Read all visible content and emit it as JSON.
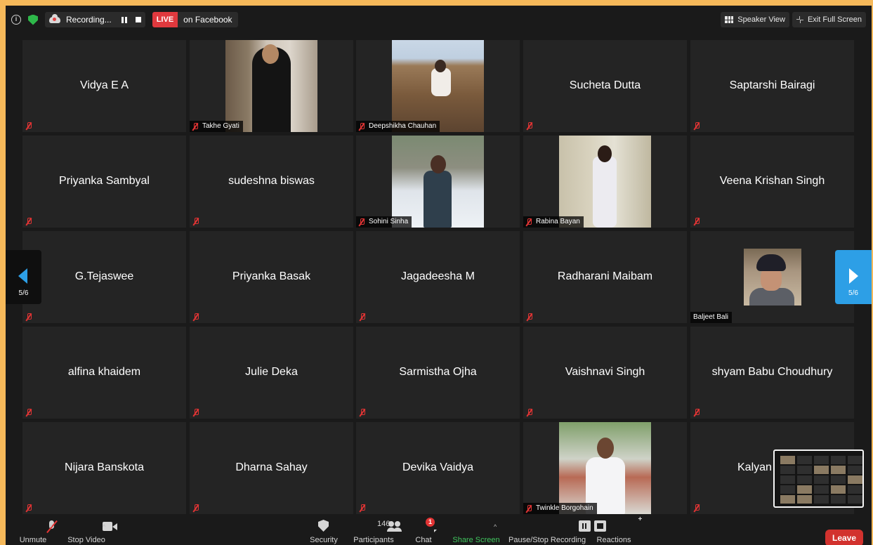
{
  "topbar": {
    "info_icon": "info-icon",
    "recording_label": "Recording...",
    "live_badge": "LIVE",
    "live_text": "on Facebook",
    "speaker_view_label": "Speaker View",
    "exit_fullscreen_label": "Exit Full Screen"
  },
  "tiles": [
    {
      "name": "Vidya E A"
    },
    {
      "name": "Takhe Gyati"
    },
    {
      "name": "Deepshikha Chauhan"
    },
    {
      "name": "Sucheta Dutta"
    },
    {
      "name": "Saptarshi Bairagi"
    },
    {
      "name": "Priyanka Sambyal"
    },
    {
      "name": "sudeshna biswas"
    },
    {
      "name": "Sohini Sinha"
    },
    {
      "name": "Rabina Bayan"
    },
    {
      "name": "Veena Krishan Singh"
    },
    {
      "name": "G.Tejaswee"
    },
    {
      "name": "Priyanka Basak"
    },
    {
      "name": "Jagadeesha M"
    },
    {
      "name": "Radharani Maibam"
    },
    {
      "name": "Baljeet Bali"
    },
    {
      "name": "alfina khaidem"
    },
    {
      "name": "Julie Deka"
    },
    {
      "name": "Sarmistha Ojha"
    },
    {
      "name": "Vaishnavi Singh"
    },
    {
      "name": "shyam Babu Choudhury"
    },
    {
      "name": "Nijara Banskota"
    },
    {
      "name": "Dharna Sahay"
    },
    {
      "name": "Devika Vaidya"
    },
    {
      "name": "Twinkle Borgohain"
    },
    {
      "name": "Kalyan"
    }
  ],
  "pager": {
    "left_count": "5/6",
    "right_count": "5/6"
  },
  "toolbar": {
    "unmute": "Unmute",
    "stop_video": "Stop Video",
    "security": "Security",
    "participants": "Participants",
    "participants_count": "146",
    "chat": "Chat",
    "chat_badge": "1",
    "share_screen": "Share Screen",
    "pause_stop_recording": "Pause/Stop Recording",
    "reactions": "Reactions",
    "leave": "Leave"
  },
  "colors": {
    "live": "#e0393e",
    "share_green": "#40c55e",
    "pager_blue": "#2d9fe6",
    "leave_red": "#d2322e",
    "muted_red": "#e23434"
  }
}
